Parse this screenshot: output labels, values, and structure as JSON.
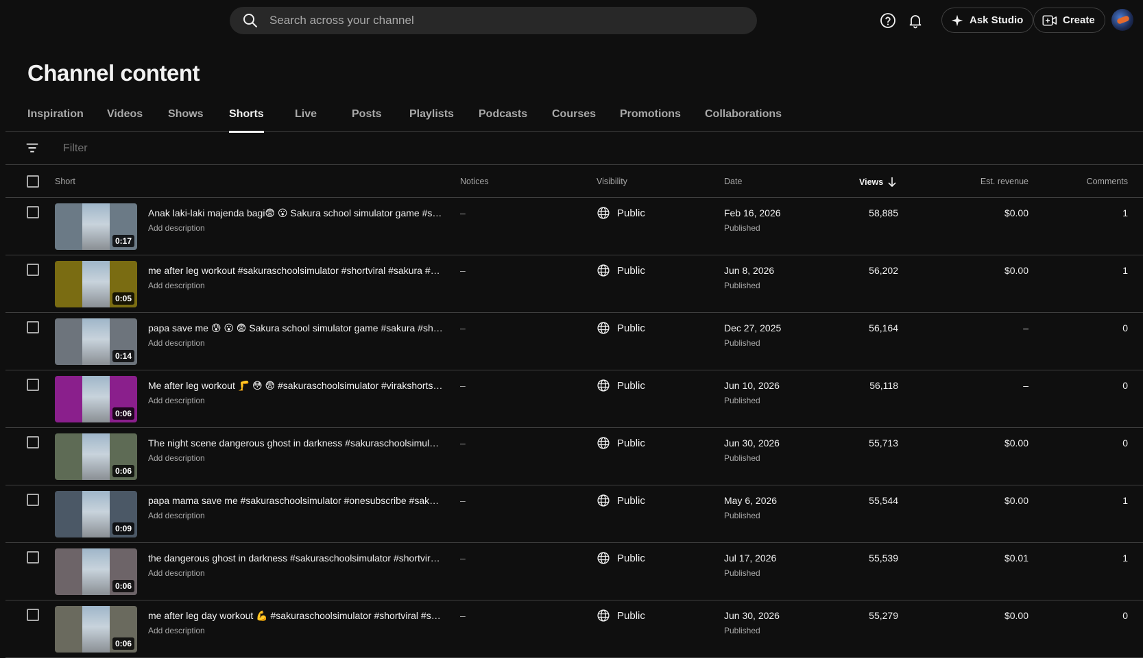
{
  "search": {
    "placeholder": "Search across your channel"
  },
  "topbar": {
    "ask_studio_label": "Ask Studio",
    "create_label": "Create"
  },
  "page": {
    "title": "Channel content"
  },
  "tabs": [
    {
      "label": "Inspiration"
    },
    {
      "label": "Videos"
    },
    {
      "label": "Shows"
    },
    {
      "label": "Shorts"
    },
    {
      "label": "Live"
    },
    {
      "label": "Posts"
    },
    {
      "label": "Playlists"
    },
    {
      "label": "Podcasts"
    },
    {
      "label": "Courses"
    },
    {
      "label": "Promotions"
    },
    {
      "label": "Collaborations"
    }
  ],
  "active_tab": "Shorts",
  "filter": {
    "placeholder": "Filter"
  },
  "columns": {
    "short": "Short",
    "notices": "Notices",
    "visibility": "Visibility",
    "date": "Date",
    "views": "Views",
    "revenue": "Est. revenue",
    "comments": "Comments"
  },
  "rows": [
    {
      "duration": "0:17",
      "title": "Anak laki-laki majenda bagi😨 😮 Sakura school simulator game #sakura #shorts",
      "desc": "Add description",
      "notice": "–",
      "visibility": "Public",
      "date": "Feb 16, 2026",
      "status": "Published",
      "views": "58,885",
      "revenue": "$0.00",
      "comments": "1",
      "color": "#6b7a86"
    },
    {
      "duration": "0:05",
      "title": "me after leg workout #sakuraschoolsimulator #shortviral #sakura #shorts",
      "desc": "Add description",
      "notice": "–",
      "visibility": "Public",
      "date": "Jun 8, 2026",
      "status": "Published",
      "views": "56,202",
      "revenue": "$0.00",
      "comments": "1",
      "color": "#7a6c12"
    },
    {
      "duration": "0:14",
      "title": "papa save me 😰 😮 😨 Sakura school simulator game #sakura #shorts",
      "desc": "Add description",
      "notice": "–",
      "visibility": "Public",
      "date": "Dec 27, 2025",
      "status": "Published",
      "views": "56,164",
      "revenue": "–",
      "comments": "0",
      "color": "#6d747c"
    },
    {
      "duration": "0:06",
      "title": "Me after leg workout 🦵 😳 😨 #sakuraschoolsimulator #virakshorts #shorts",
      "desc": "Add description",
      "notice": "–",
      "visibility": "Public",
      "date": "Jun 10, 2026",
      "status": "Published",
      "views": "56,118",
      "revenue": "–",
      "comments": "0",
      "color": "#8a1f8c"
    },
    {
      "duration": "0:06",
      "title": "The night scene dangerous ghost in darkness #sakuraschoolsimulator #shorts",
      "desc": "Add description",
      "notice": "–",
      "visibility": "Public",
      "date": "Jun 30, 2026",
      "status": "Published",
      "views": "55,713",
      "revenue": "$0.00",
      "comments": "0",
      "color": "#5e6b55"
    },
    {
      "duration": "0:09",
      "title": "papa mama save me #sakuraschoolsimulator #onesubscribe #sakura #shorts",
      "desc": "Add description",
      "notice": "–",
      "visibility": "Public",
      "date": "May 6, 2026",
      "status": "Published",
      "views": "55,544",
      "revenue": "$0.00",
      "comments": "1",
      "color": "#4b5866"
    },
    {
      "duration": "0:06",
      "title": "the dangerous ghost in darkness #sakuraschoolsimulator #shortviral #shorts",
      "desc": "Add description",
      "notice": "–",
      "visibility": "Public",
      "date": "Jul 17, 2026",
      "status": "Published",
      "views": "55,539",
      "revenue": "$0.01",
      "comments": "1",
      "color": "#6d6468"
    },
    {
      "duration": "0:06",
      "title": "me after leg day workout 💪 #sakuraschoolsimulator #shortviral #shorts",
      "desc": "Add description",
      "notice": "–",
      "visibility": "Public",
      "date": "Jun 30, 2026",
      "status": "Published",
      "views": "55,279",
      "revenue": "$0.00",
      "comments": "0",
      "color": "#6a6a5e"
    }
  ]
}
